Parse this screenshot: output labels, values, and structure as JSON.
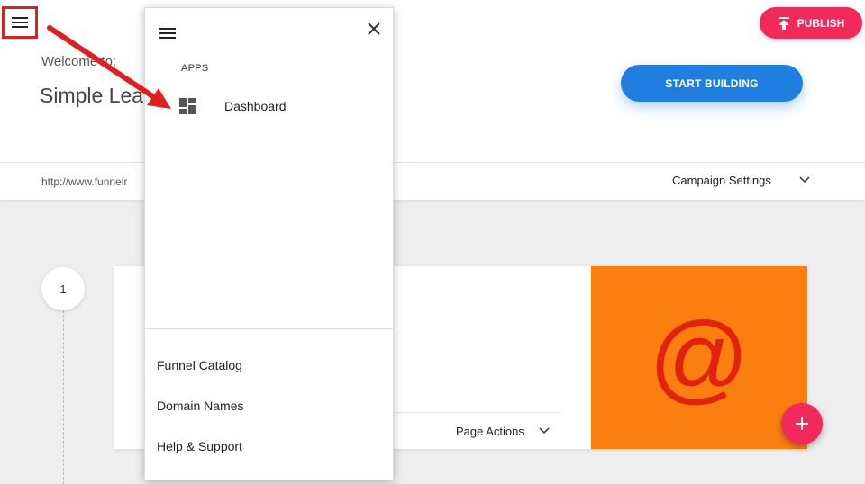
{
  "header": {
    "welcome_text": "Welcome to:",
    "campaign_title": "Simple Lead",
    "publish_label": "PUBLISH",
    "start_building_label": "START BUILDING"
  },
  "urlbar": {
    "url": "http://www.funnelr",
    "campaign_settings_label": "Campaign Settings"
  },
  "steps": [
    {
      "number": "1",
      "page_actions_label": "Page Actions",
      "thumbnail_symbol": "@"
    }
  ],
  "drawer": {
    "apps_heading": "APPS",
    "apps": [
      {
        "label": "Dashboard",
        "icon": "dashboard-icon"
      }
    ],
    "links": [
      {
        "label": "Funnel Catalog"
      },
      {
        "label": "Domain Names"
      },
      {
        "label": "Help & Support"
      }
    ]
  },
  "icons": {
    "menu": "hamburger-menu-icon",
    "close": "close-icon",
    "publish": "upload-icon",
    "add": "plus-icon",
    "chevron": "chevron-down-icon"
  },
  "colors": {
    "publish": "#f2295b",
    "start_building": "#1e7fe0",
    "thumbnail_bg": "#fb7f0e",
    "thumbnail_symbol": "#e0220f",
    "annotation": "#e0201f"
  }
}
